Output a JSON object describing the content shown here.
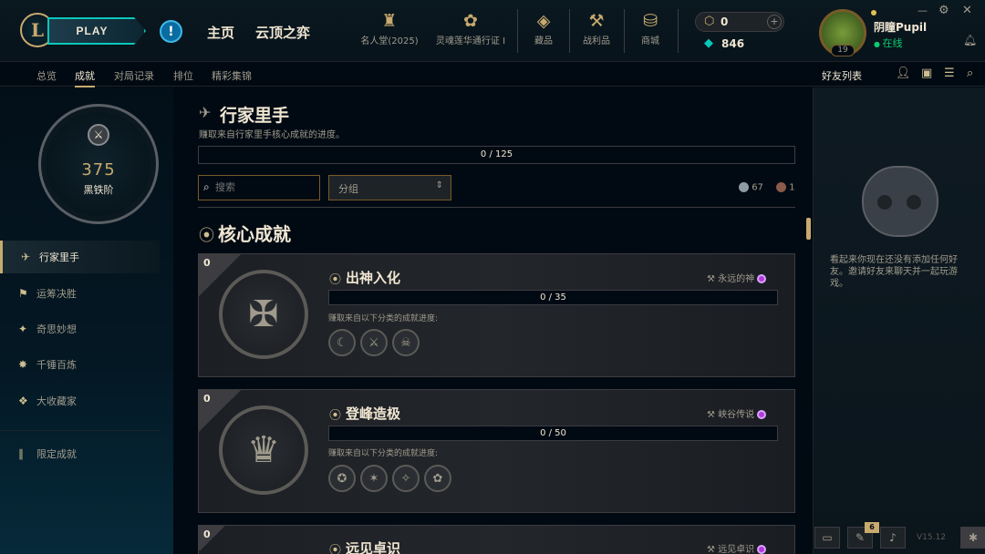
{
  "header": {
    "logo": "L",
    "play": "PLAY",
    "alert": "!",
    "nav": [
      "主页",
      "云顶之弈"
    ],
    "icons": [
      {
        "label": "名人堂(2025)",
        "icon": "♜"
      },
      {
        "label": "灵魂莲华通行证 I",
        "icon": "✿"
      },
      {
        "label": "藏品",
        "icon": "◈"
      },
      {
        "label": "战利品",
        "icon": "⚒"
      },
      {
        "label": "商城",
        "icon": "⛁"
      }
    ],
    "rp": "0",
    "be": "846",
    "user": {
      "name": "阴瞳Pupil",
      "status": "在线",
      "level": "19"
    }
  },
  "subnav": [
    "总览",
    "成就",
    "对局记录",
    "排位",
    "精彩集锦"
  ],
  "friends": {
    "title": "好友列表",
    "empty": "看起来你现在还没有添加任何好友。邀请好友来聊天并一起玩游戏。",
    "version": "V15.12",
    "badge": "6"
  },
  "rank": {
    "points": "375",
    "tier": "黑铁阶"
  },
  "leftnav": [
    {
      "label": "行家里手",
      "icon": "✈"
    },
    {
      "label": "运筹决胜",
      "icon": "⚑"
    },
    {
      "label": "奇思妙想",
      "icon": "✦"
    },
    {
      "label": "千锤百炼",
      "icon": "✸"
    },
    {
      "label": "大收藏家",
      "icon": "❖"
    },
    {
      "label": "限定成就",
      "icon": "∥"
    }
  ],
  "main": {
    "title": "行家里手",
    "subtitle": "赚取来自行家里手核心成就的进度。",
    "progress": "0 / 125",
    "progress_fraction": 0,
    "search_placeholder": "搜索",
    "group": "分组",
    "stat1": "67",
    "stat2": "1",
    "section": "核心成就",
    "cards": [
      {
        "num": "0",
        "title": "出神入化",
        "progress": "0 / 35",
        "desc": "赚取来自以下分类的成就进度:",
        "tag": "永远的神",
        "emblem": "✠",
        "minis": [
          "☾",
          "⚔",
          "☠"
        ]
      },
      {
        "num": "0",
        "title": "登峰造极",
        "progress": "0 / 50",
        "desc": "赚取来自以下分类的成就进度:",
        "tag": "峡谷传说",
        "emblem": "♛",
        "minis": [
          "✪",
          "✶",
          "✧",
          "✿"
        ]
      },
      {
        "num": "0",
        "title": "远见卓识",
        "tag": "远见卓识"
      }
    ]
  }
}
